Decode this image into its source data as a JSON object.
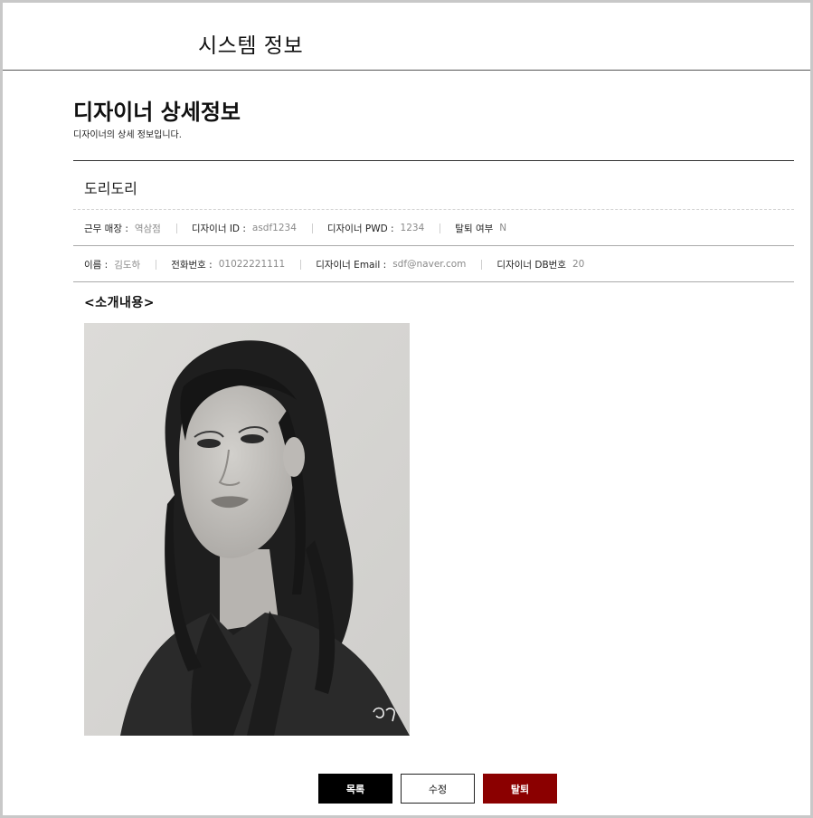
{
  "header": {
    "title": "시스템 정보"
  },
  "page": {
    "title": "디자이너 상세정보",
    "subtitle": "디자이너의 상세 정보입니다."
  },
  "designer": {
    "name": "도리도리",
    "row1": [
      {
        "label": "근무 매장 :",
        "value": "역삼점"
      },
      {
        "label": "디자이너 ID :",
        "value": "asdf1234"
      },
      {
        "label": "디자이너 PWD :",
        "value": "1234"
      },
      {
        "label": "탈퇴 여부",
        "value": "N"
      }
    ],
    "row2": [
      {
        "label": "이름 :",
        "value": "김도하"
      },
      {
        "label": "전화번호 :",
        "value": "01022221111"
      },
      {
        "label": "디자이너 Email :",
        "value": "sdf@naver.com"
      },
      {
        "label": "디자이너 DB번호",
        "value": "20"
      }
    ]
  },
  "intro": {
    "heading": "<소개내용>",
    "image_alt": "designer profile photo (black and white portrait)"
  },
  "buttons": {
    "list_label": "목록",
    "edit_label": "수정",
    "withdraw_label": "탈퇴"
  },
  "colors": {
    "list_button": "#000000",
    "withdraw_button": "#8b0000",
    "muted_value": "#8a8a8a"
  }
}
